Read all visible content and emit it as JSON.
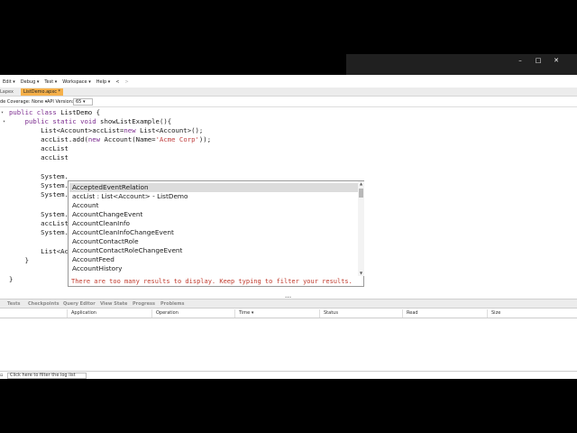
{
  "window": {
    "controls": {
      "minimize": "–",
      "maximize": "□",
      "close": "✕"
    }
  },
  "menu": [
    "Edit ▾",
    "Debug ▾",
    "Test ▾",
    "Workspace ▾",
    "Help ▾",
    "<",
    ">"
  ],
  "tabs": {
    "previous": "Lapex",
    "active": "ListDemo.apxc *"
  },
  "toolbar": {
    "coverage_label": "de Coverage: None ▾",
    "coverage_arrow": "▾",
    "api_label": "API Version:",
    "api_value": "65 ▾"
  },
  "editor": {
    "lines": [
      [
        "public class ListDemo {"
      ],
      [
        "    public static void showListExample(){"
      ],
      [
        "        List<Account>accList=new List<Account>();"
      ],
      [
        "        accList.add(new Account(Name='Acme Corp'));"
      ],
      [
        "        accList"
      ],
      [
        "        accList"
      ],
      [
        ""
      ],
      [
        "        System."
      ],
      [
        "        System."
      ],
      [
        "        System."
      ],
      [
        ""
      ],
      [
        "        System."
      ],
      [
        "        accList"
      ],
      [
        "        System."
      ],
      [
        ""
      ],
      [
        "        List<Account>"
      ],
      [
        "    }"
      ],
      [
        ""
      ],
      [
        "}"
      ]
    ]
  },
  "autocomplete": {
    "items": [
      "AcceptedEventRelation",
      "accList : List<Account> - ListDemo",
      "Account",
      "AccountChangeEvent",
      "AccountCleanInfo",
      "AccountCleanInfoChangeEvent",
      "AccountContactRole",
      "AccountContactRoleChangeEvent",
      "AccountFeed",
      "AccountHistory"
    ],
    "selected_index": 0,
    "footer": "There are too many results to display. Keep typing to filter your results."
  },
  "bottom_tabs": [
    "Tests",
    "Checkpoints",
    "Query Editor",
    "View State",
    "Progress",
    "Problems"
  ],
  "log_columns": [
    "Application",
    "Operation",
    "Time ▾",
    "Status",
    "Read",
    "Size"
  ],
  "filter": {
    "placeholder": "Click here to filter the log list"
  }
}
